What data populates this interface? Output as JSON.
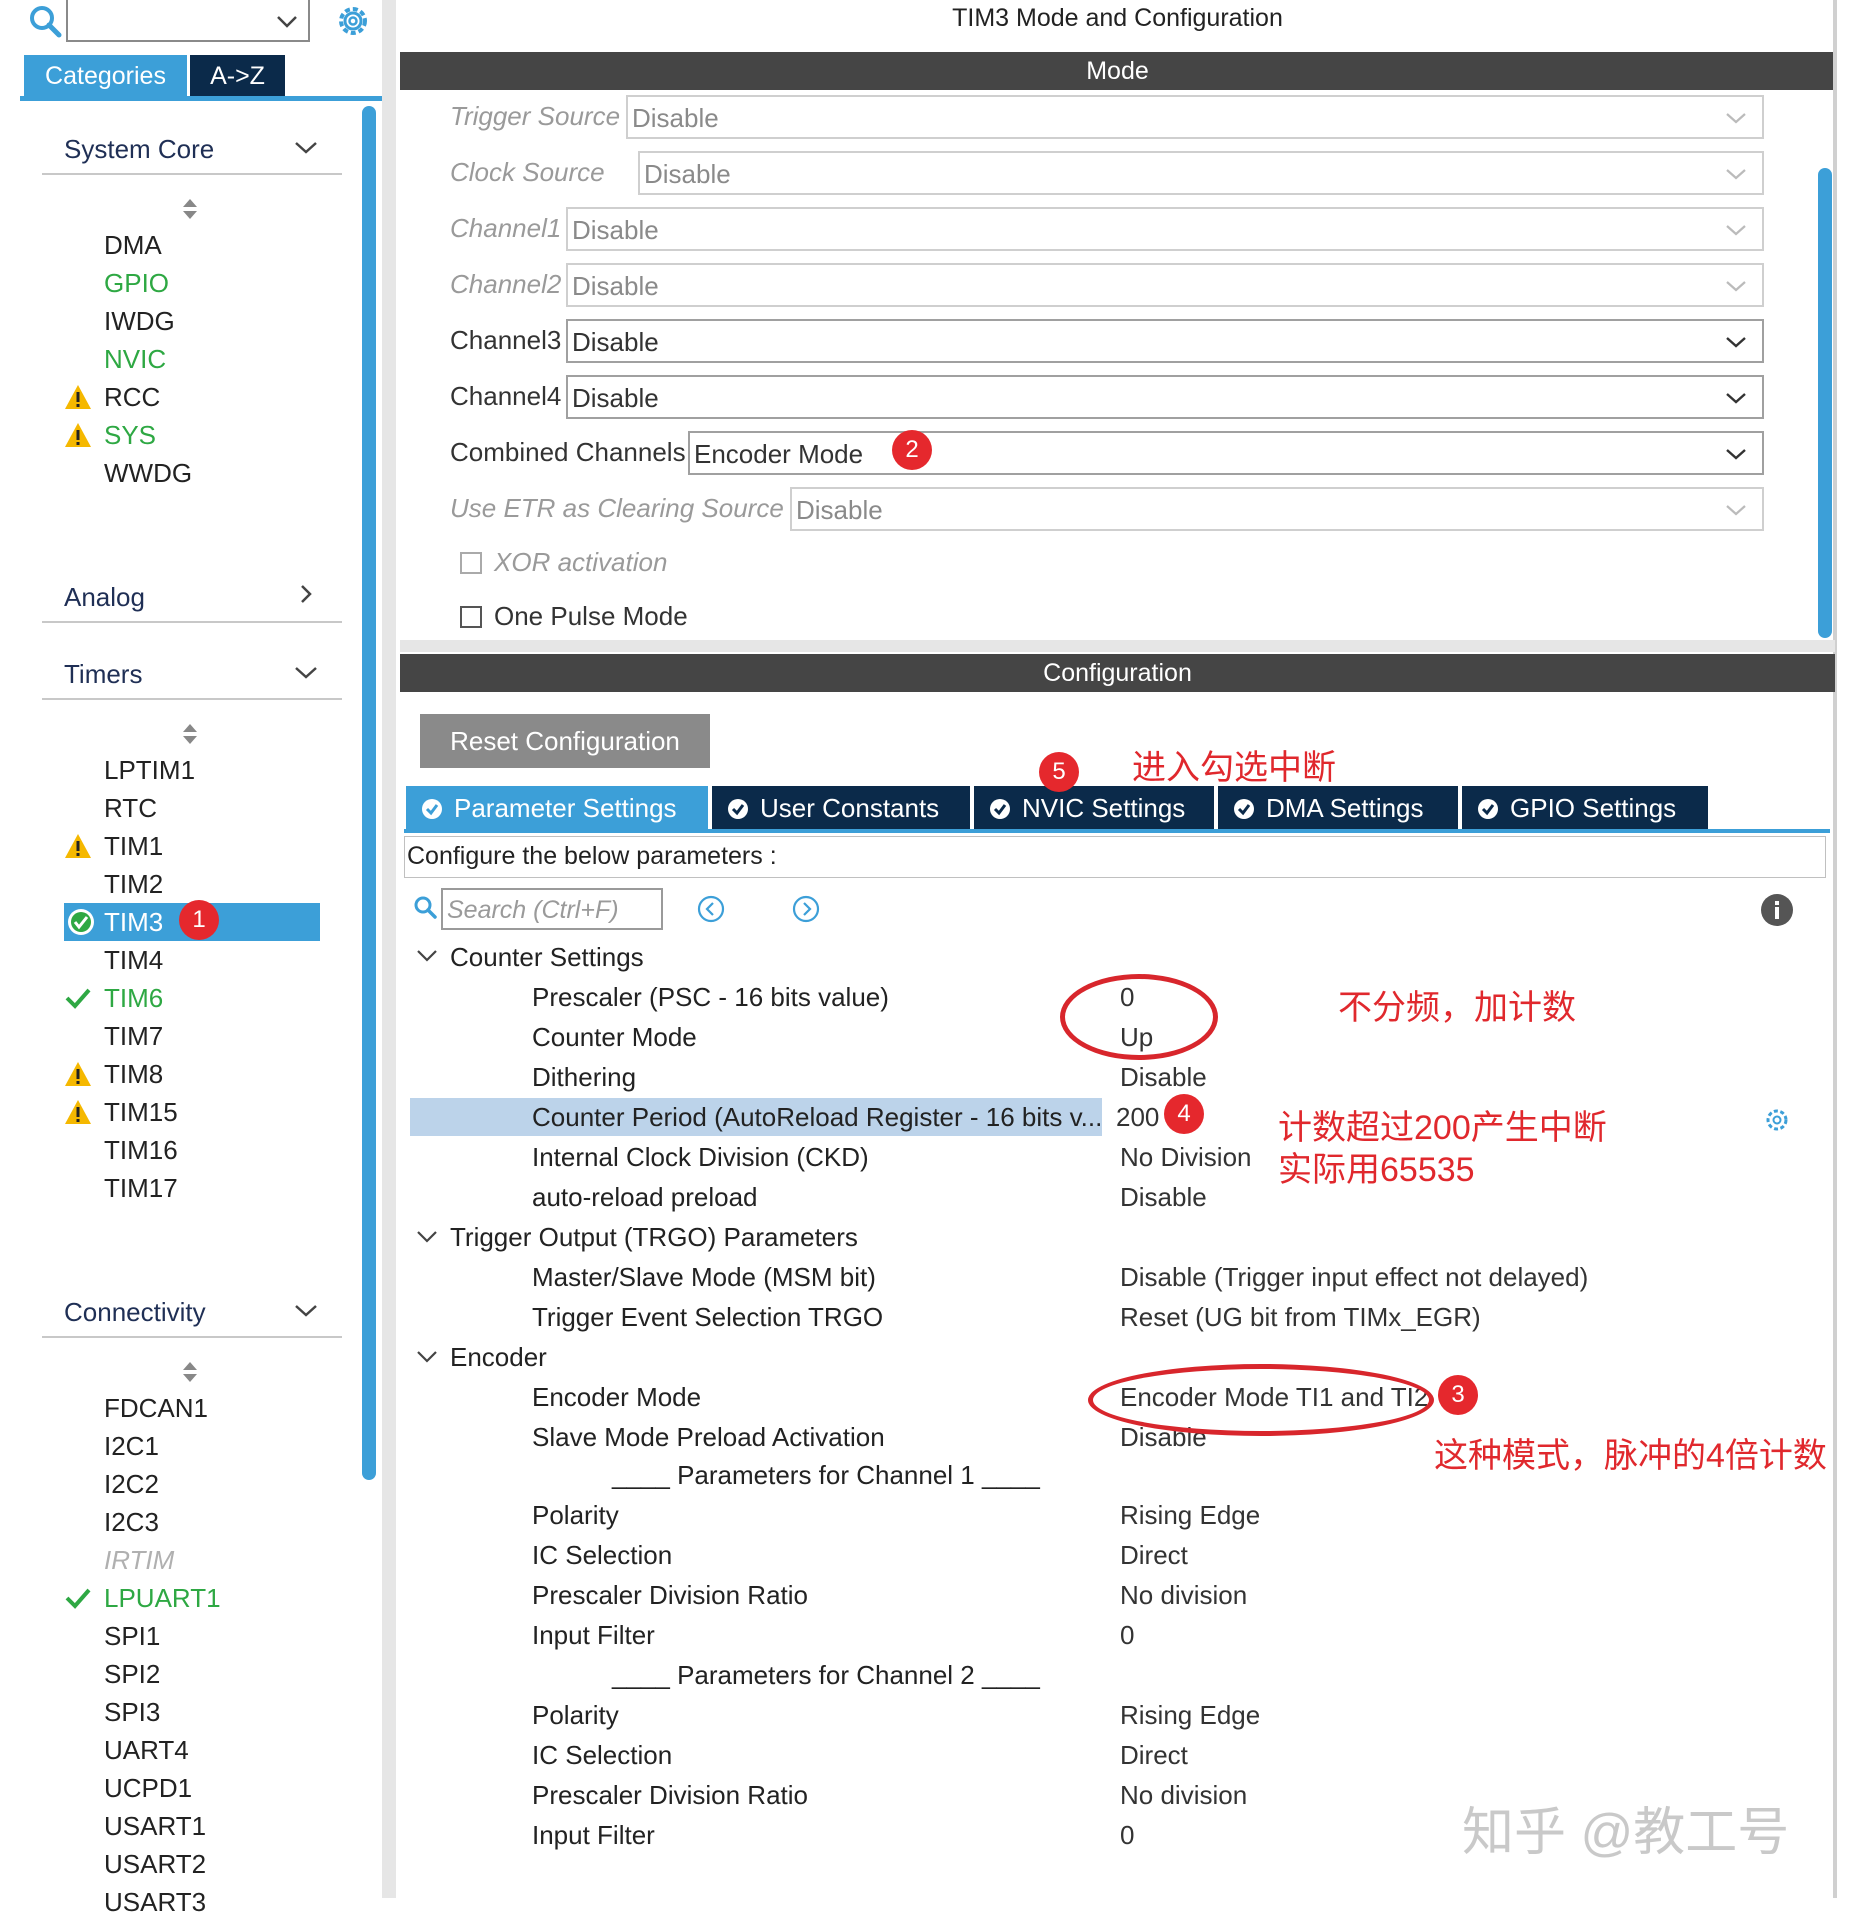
{
  "left": {
    "top_tabs": [
      "Categories",
      "A->Z"
    ],
    "categories": {
      "system_core": {
        "label": "System Core",
        "items": [
          "DMA",
          "GPIO",
          "IWDG",
          "NVIC",
          "RCC",
          "SYS",
          "WWDG"
        ]
      },
      "analog": {
        "label": "Analog"
      },
      "timers": {
        "label": "Timers",
        "items": [
          "LPTIM1",
          "RTC",
          "TIM1",
          "TIM2",
          "TIM3",
          "TIM4",
          "TIM6",
          "TIM7",
          "TIM8",
          "TIM15",
          "TIM16",
          "TIM17"
        ]
      },
      "connectivity": {
        "label": "Connectivity",
        "items": [
          "FDCAN1",
          "I2C1",
          "I2C2",
          "I2C3",
          "IRTIM",
          "LPUART1",
          "SPI1",
          "SPI2",
          "SPI3",
          "UART4",
          "UCPD1",
          "USART1",
          "USART2",
          "USART3"
        ]
      }
    }
  },
  "title": "TIM3 Mode and Configuration",
  "mode": {
    "header": "Mode",
    "rows": [
      {
        "label": "Trigger Source",
        "value": "Disable"
      },
      {
        "label": "Clock Source",
        "value": "Disable"
      },
      {
        "label": "Channel1",
        "value": "Disable"
      },
      {
        "label": "Channel2",
        "value": "Disable"
      },
      {
        "label": "Channel3",
        "value": "Disable"
      },
      {
        "label": "Channel4",
        "value": "Disable"
      },
      {
        "label": "Combined Channels",
        "value": "Encoder Mode"
      },
      {
        "label": "Use ETR as Clearing Source",
        "value": "Disable"
      }
    ],
    "xor_label": "XOR activation",
    "one_pulse_label": "One Pulse Mode"
  },
  "config": {
    "header": "Configuration",
    "reset_label": "Reset Configuration",
    "tabs": [
      "Parameter Settings",
      "User Constants",
      "NVIC Settings",
      "DMA Settings",
      "GPIO Settings"
    ],
    "configure_text": "Configure the below parameters :",
    "search_placeholder": "Search (Ctrl+F)",
    "sections": {
      "counter": {
        "title": "Counter Settings",
        "params": [
          {
            "label": "Prescaler (PSC - 16 bits value)",
            "value": "0"
          },
          {
            "label": "Counter Mode",
            "value": "Up"
          },
          {
            "label": "Dithering",
            "value": "Disable"
          },
          {
            "label": "Counter Period (AutoReload Register - 16 bits v...",
            "value": "200"
          },
          {
            "label": "Internal Clock Division (CKD)",
            "value": "No Division"
          },
          {
            "label": "auto-reload preload",
            "value": "Disable"
          }
        ]
      },
      "trgo": {
        "title": "Trigger Output (TRGO) Parameters",
        "params": [
          {
            "label": "Master/Slave Mode (MSM bit)",
            "value": "Disable (Trigger input effect not delayed)"
          },
          {
            "label": "Trigger Event Selection TRGO",
            "value": "Reset (UG bit from TIMx_EGR)"
          }
        ]
      },
      "encoder": {
        "title": "Encoder",
        "params": [
          {
            "label": "Encoder Mode",
            "value": "Encoder Mode TI1 and TI2"
          },
          {
            "label": "Slave Mode Preload Activation",
            "value": "Disable"
          }
        ],
        "ch1_title": "____ Parameters for Channel 1 ____",
        "ch1": [
          {
            "label": "Polarity",
            "value": "Rising Edge"
          },
          {
            "label": "IC Selection",
            "value": "Direct"
          },
          {
            "label": "Prescaler Division Ratio",
            "value": "No division"
          },
          {
            "label": "Input Filter",
            "value": "0"
          }
        ],
        "ch2_title": "____ Parameters for Channel 2 ____",
        "ch2": [
          {
            "label": "Polarity",
            "value": "Rising Edge"
          },
          {
            "label": "IC Selection",
            "value": "Direct"
          },
          {
            "label": "Prescaler Division Ratio",
            "value": "No division"
          },
          {
            "label": "Input Filter",
            "value": "0"
          }
        ]
      }
    }
  },
  "annotations": {
    "badges": [
      "1",
      "2",
      "3",
      "4",
      "5"
    ],
    "nvic_note": "进入勾选中断",
    "prescaler_note": "不分频，加计数",
    "period_note_1": "计数超过200产生中断",
    "period_note_2": "实际用65535",
    "encoder_note": "这种模式，脉冲的4倍计数"
  },
  "watermark": "知乎 @教工号",
  "colors": {
    "accent": "#3c9fd8",
    "dark_tab": "#0b2a4a",
    "header": "#454545",
    "annotation_red": "#e0282d",
    "ok_green": "#2ea843",
    "warn_yellow": "#f5b800"
  }
}
